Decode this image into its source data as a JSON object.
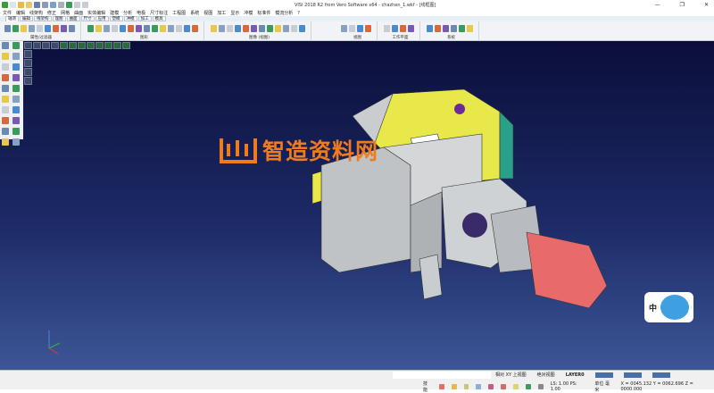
{
  "title": "VISI 2018 R2 from Vero Software x64 - chazhen_1.wkf - [线框图]",
  "window_controls": [
    "—",
    "❐",
    "✕"
  ],
  "menu": [
    "文件",
    "编辑",
    "线架构",
    "修正",
    "网格",
    "曲面",
    "实体编辑",
    "建模",
    "分析",
    "电极",
    "尺寸标注",
    "工程图",
    "系统",
    "视图",
    "加工",
    "显示",
    "冲模",
    "标准件",
    "模流分析",
    "?"
  ],
  "tabs": [
    "轴测",
    "编辑",
    "线架构",
    "理图",
    "曲面",
    "尺寸",
    "应用",
    "塑模",
    "冲模",
    "加工",
    "模具"
  ],
  "active_tab": 0,
  "ribbon_groups": [
    {
      "label": "属性/过滤器",
      "icons": 9
    },
    {
      "label": "图形",
      "icons": 14
    },
    {
      "label": "图像 (视图)",
      "icons": 12
    },
    {
      "label": "视图",
      "icons": 4
    },
    {
      "label": "工作平面",
      "icons": 4
    },
    {
      "label": "系统",
      "icons": 6
    }
  ],
  "watermark": "智造资料网",
  "status": {
    "workplane": "相对 XY 上视图",
    "view": "绝对视图",
    "layer": "LAYER0",
    "mode": "技能",
    "scale": "LS: 1.00 PS: 1.00",
    "unit": "单位 毫米",
    "coords": "X = 0045.132 Y = 0062.696 Z = 0000.000"
  },
  "ime_badge": "中",
  "colors": {
    "accent": "#4a6fa5",
    "watermark": "#f07a1e",
    "model_yellow": "#e8e84a",
    "motor_red": "#e86a6a"
  }
}
